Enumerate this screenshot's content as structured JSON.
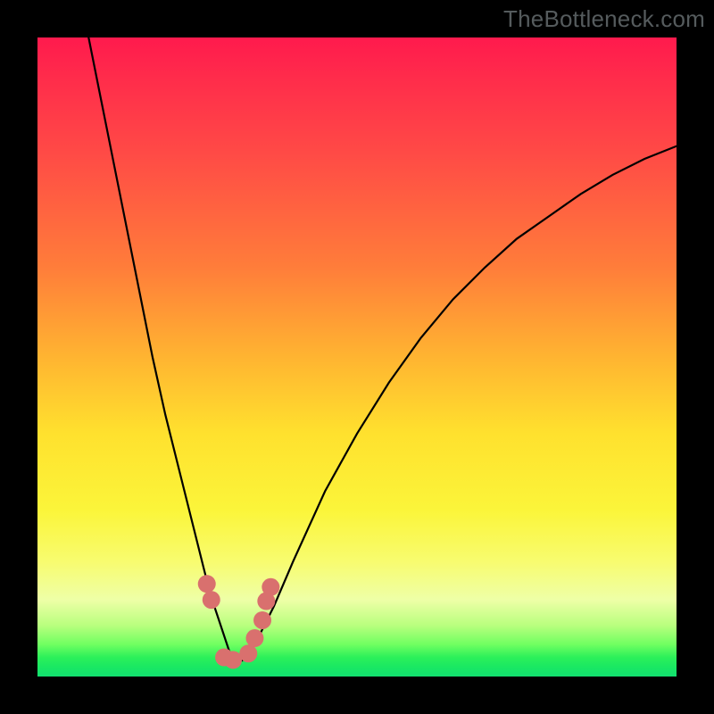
{
  "watermark": "TheBottleneck.com",
  "chart_data": {
    "type": "line",
    "title": "",
    "xlabel": "",
    "ylabel": "",
    "xlim": [
      0,
      100
    ],
    "ylim": [
      0,
      100
    ],
    "grid": false,
    "legend": false,
    "note": "Axes are unlabeled; values are estimated from pixel positions in a 0–100 normalized space. Curve is a V-shaped dip with minimum near x≈31. Clustered salmon dot markers sit near the trough.",
    "series": [
      {
        "name": "curve",
        "type": "line",
        "x": [
          8,
          10,
          12,
          14,
          16,
          18,
          20,
          22,
          24,
          26,
          27,
          28,
          29,
          30,
          31,
          32,
          33,
          34,
          35,
          37,
          40,
          45,
          50,
          55,
          60,
          65,
          70,
          75,
          80,
          85,
          90,
          95,
          100
        ],
        "y": [
          100,
          90,
          80,
          70,
          60,
          50,
          41,
          33,
          25,
          17,
          13,
          10,
          7,
          4,
          2.5,
          2.5,
          3.5,
          5,
          7,
          11,
          18,
          29,
          38,
          46,
          53,
          59,
          64,
          68.5,
          72,
          75.5,
          78.5,
          81,
          83
        ]
      },
      {
        "name": "markers",
        "type": "scatter",
        "x": [
          26.5,
          27.2,
          29.2,
          30.6,
          33.0,
          34.0,
          35.2,
          35.8,
          36.5
        ],
        "y": [
          14.5,
          12.0,
          3.0,
          2.6,
          3.6,
          6.0,
          8.8,
          11.8,
          14.0
        ]
      }
    ],
    "colors": {
      "gradient_top": "#ff1a4d",
      "gradient_mid": "#ffe12e",
      "gradient_bottom": "#12e070",
      "curve": "#000000",
      "marker": "#d9706e",
      "frame": "#000000"
    }
  }
}
